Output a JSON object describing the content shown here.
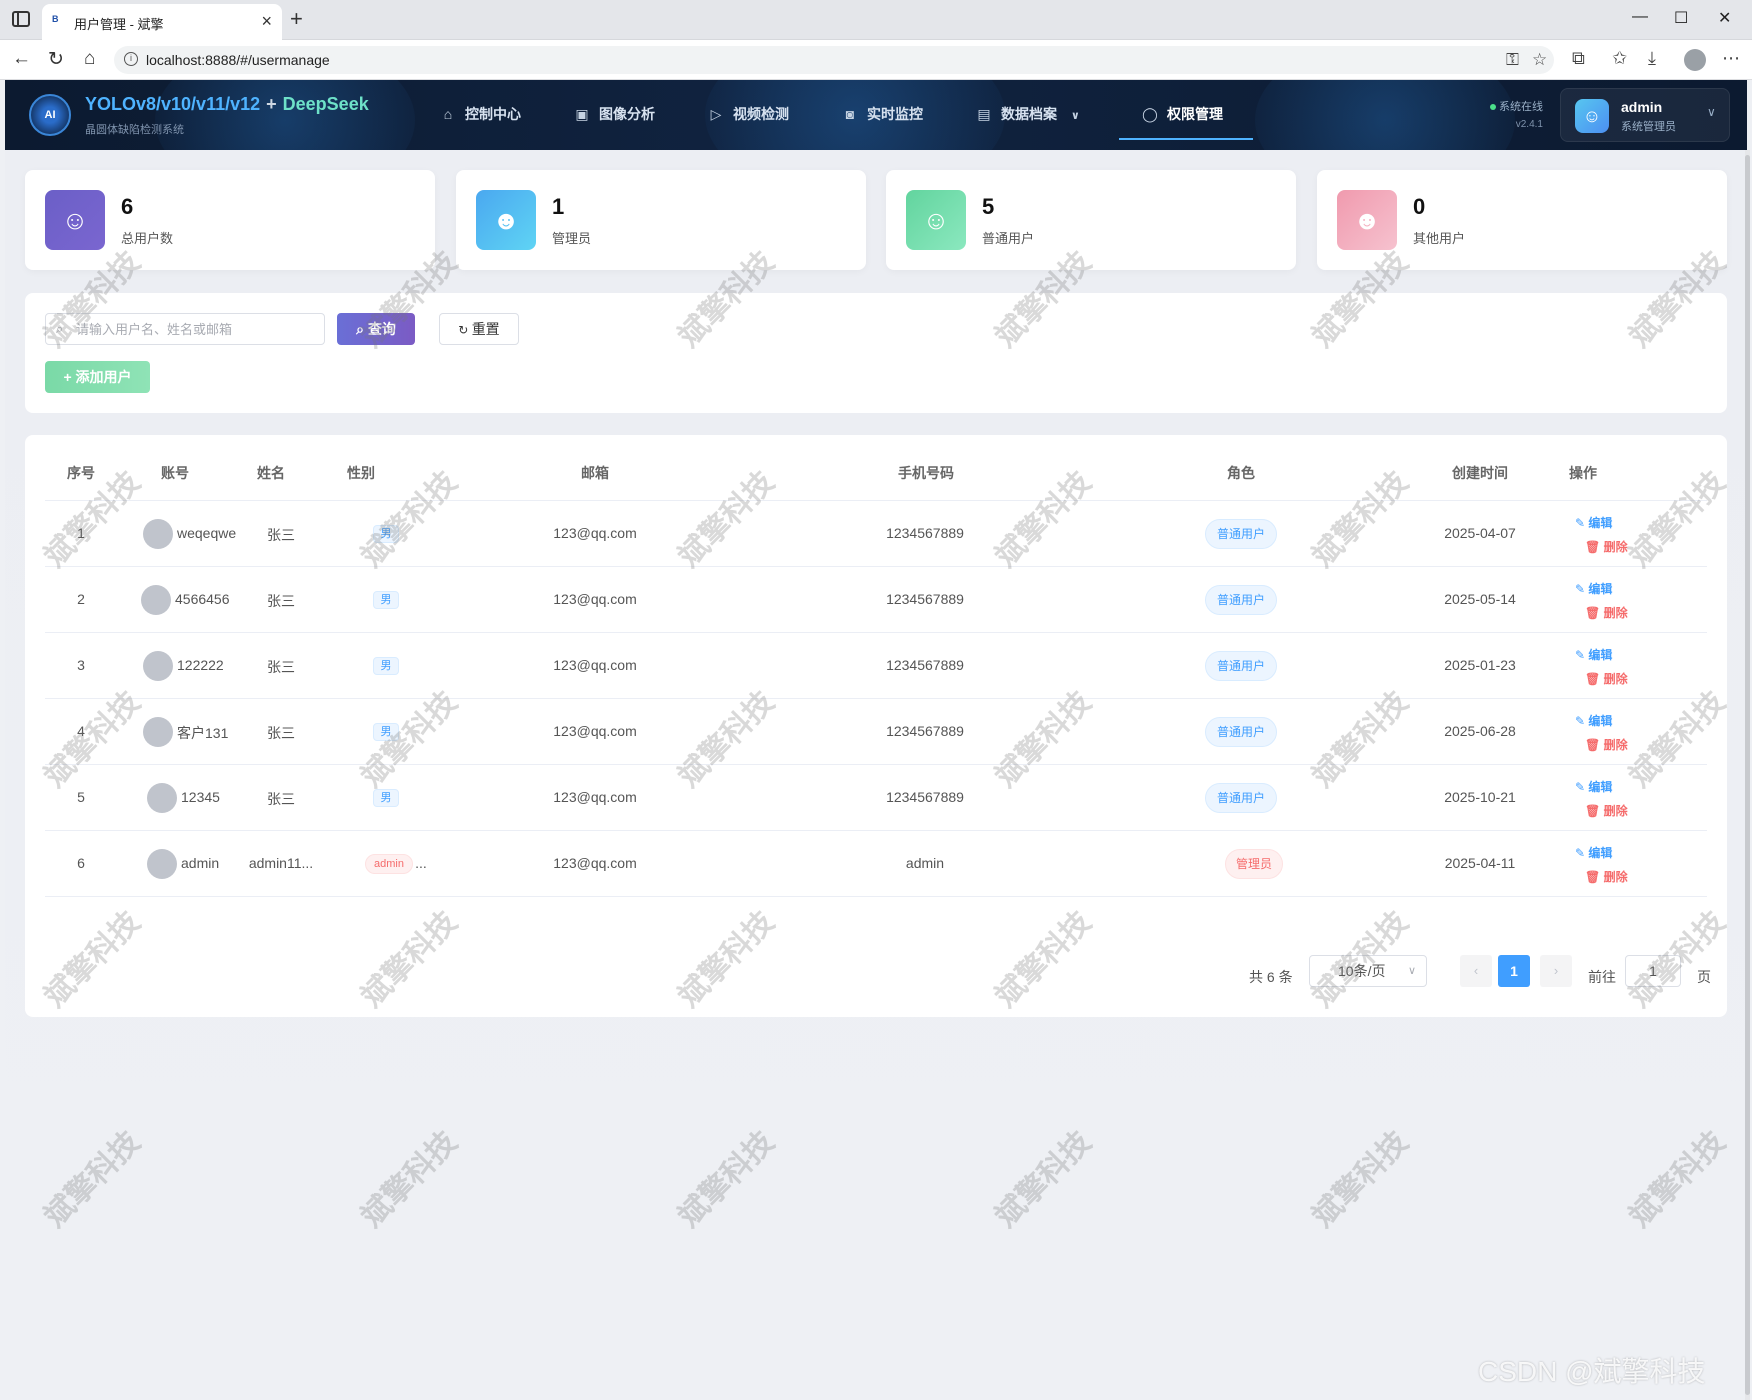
{
  "browser": {
    "tab_title": "用户管理 - 斌擎",
    "tab_favicon": "B",
    "url": "localhost:8888/#/usermanage",
    "icons": [
      "back-icon",
      "refresh-icon",
      "home-icon",
      "key-icon",
      "star-icon",
      "extensions-icon",
      "favorites-icon",
      "download-icon",
      "profile-icon",
      "more-icon"
    ]
  },
  "header": {
    "logo_text": "AI",
    "brand_title": "YOLOv8/v10/v11/v12",
    "brand_plus": "+",
    "brand_suffix": "DeepSeek",
    "brand_sub": "晶圆体缺陷检测系统",
    "menu": [
      {
        "label": "控制中心",
        "icon": "home-icon"
      },
      {
        "label": "图像分析",
        "icon": "image-icon"
      },
      {
        "label": "视频检测",
        "icon": "play-icon"
      },
      {
        "label": "实时监控",
        "icon": "camera-icon"
      },
      {
        "label": "数据档案",
        "icon": "document-icon"
      },
      {
        "label": "权限管理",
        "icon": "user-icon",
        "active": true
      }
    ],
    "status": "系统在线",
    "version": "v2.4.1",
    "user_name": "admin",
    "user_role": "系统管理员"
  },
  "stats": [
    {
      "value": "6",
      "label": "总用户数",
      "color": "#6b5fc7"
    },
    {
      "value": "1",
      "label": "管理员",
      "color": "#4ab2f2"
    },
    {
      "value": "5",
      "label": "普通用户",
      "color": "#6fdca4"
    },
    {
      "value": "0",
      "label": "其他用户",
      "color": "#f0a3b4"
    }
  ],
  "search": {
    "placeholder": "请输入用户名、姓名或邮箱",
    "query_label": "查询",
    "reset_label": "重置",
    "add_label": "添加用户"
  },
  "table": {
    "headers": [
      "序号",
      "账号",
      "姓名",
      "性别",
      "邮箱",
      "手机号码",
      "角色",
      "创建时间",
      "操作"
    ],
    "edit_label": "编辑",
    "delete_label": "删除",
    "rows": [
      {
        "index": "1",
        "account": "weqeqwe",
        "name": "张三",
        "gender": "男",
        "email": "123@qq.com",
        "phone": "1234567889",
        "role": "普通用户",
        "created": "2025-04-07"
      },
      {
        "index": "2",
        "account": "4566456",
        "name": "张三",
        "gender": "男",
        "email": "123@qq.com",
        "phone": "1234567889",
        "role": "普通用户",
        "created": "2025-05-14"
      },
      {
        "index": "3",
        "account": "122222",
        "name": "张三",
        "gender": "男",
        "email": "123@qq.com",
        "phone": "1234567889",
        "role": "普通用户",
        "created": "2025-01-23"
      },
      {
        "index": "4",
        "account": "客户131",
        "name": "张三",
        "gender": "男",
        "email": "123@qq.com",
        "phone": "1234567889",
        "role": "普通用户",
        "created": "2025-06-28"
      },
      {
        "index": "5",
        "account": "12345",
        "name": "张三",
        "gender": "男",
        "email": "123@qq.com",
        "phone": "1234567889",
        "role": "普通用户",
        "created": "2025-10-21"
      },
      {
        "index": "6",
        "account": "admin",
        "name": "admin11...",
        "gender": "admin",
        "gender_more": "...",
        "email": "123@qq.com",
        "phone": "admin",
        "role": "管理员",
        "created": "2025-04-11"
      }
    ]
  },
  "pagination": {
    "total": "共 6 条",
    "page_size": "10条/页",
    "current": "1",
    "goto_label": "前往",
    "goto_value": "1",
    "page_label": "页"
  },
  "watermark": "斌擎科技",
  "csdn_mark": "CSDN @斌擎科技"
}
